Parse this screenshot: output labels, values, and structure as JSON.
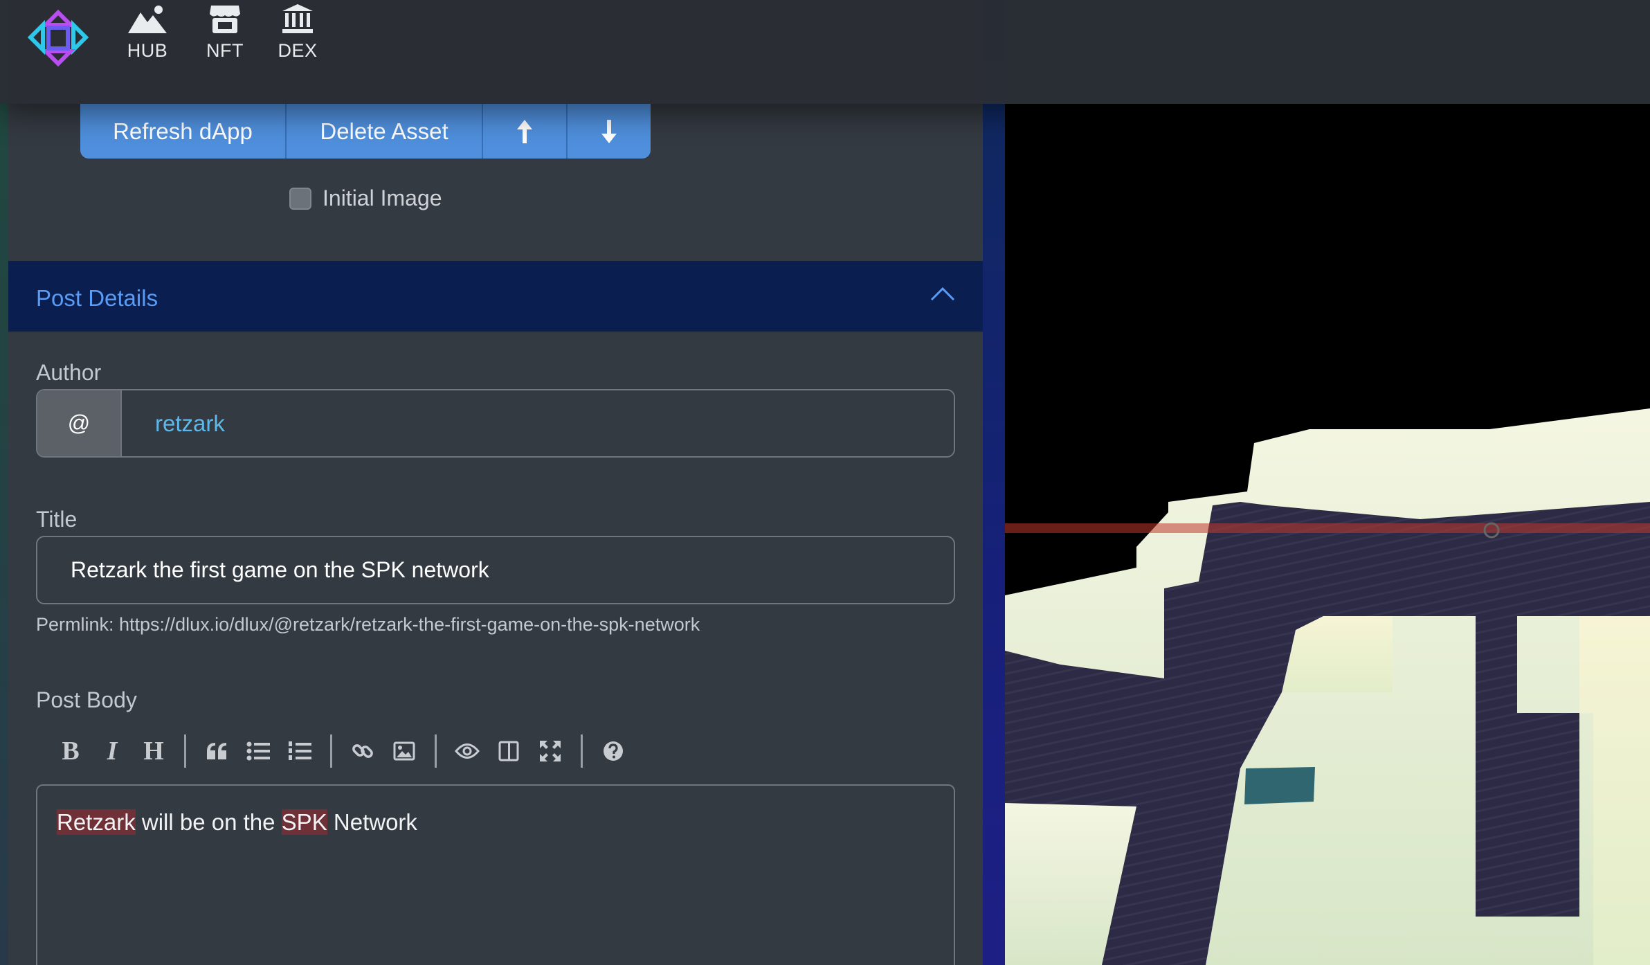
{
  "nav": {
    "items": [
      {
        "label": "HUB",
        "icon": "mountain-icon"
      },
      {
        "label": "NFT",
        "icon": "store-icon"
      },
      {
        "label": "DEX",
        "icon": "bank-icon"
      }
    ]
  },
  "asset_controls": {
    "refresh_label": "Refresh dApp",
    "delete_label": "Delete Asset",
    "move_up_icon": "arrow-up-icon",
    "move_down_icon": "arrow-down-icon",
    "initial_image_label": "Initial Image",
    "initial_image_checked": false
  },
  "post_details": {
    "header": "Post Details",
    "author_label": "Author",
    "author_prefix": "@",
    "author_value": "retzark",
    "title_label": "Title",
    "title_value": "Retzark the first game on the SPK network",
    "permalink": "Permlink: https://dlux.io/dlux/@retzark/retzark-the-first-game-on-the-spk-network",
    "body_label": "Post Body",
    "body_segments": [
      {
        "text": "Retzark",
        "misspelled": true
      },
      {
        "text": " will be on the ",
        "misspelled": false
      },
      {
        "text": "SPK",
        "misspelled": true
      },
      {
        "text": " Network",
        "misspelled": false
      }
    ]
  },
  "editor_toolbar": {
    "bold": "B",
    "italic": "I",
    "heading": "H"
  },
  "colors": {
    "primary_button": "#4f8fdc",
    "accordion_header": "#0a1f4f",
    "accordion_title": "#5a9cf5",
    "author_text": "#5eb9ea"
  }
}
